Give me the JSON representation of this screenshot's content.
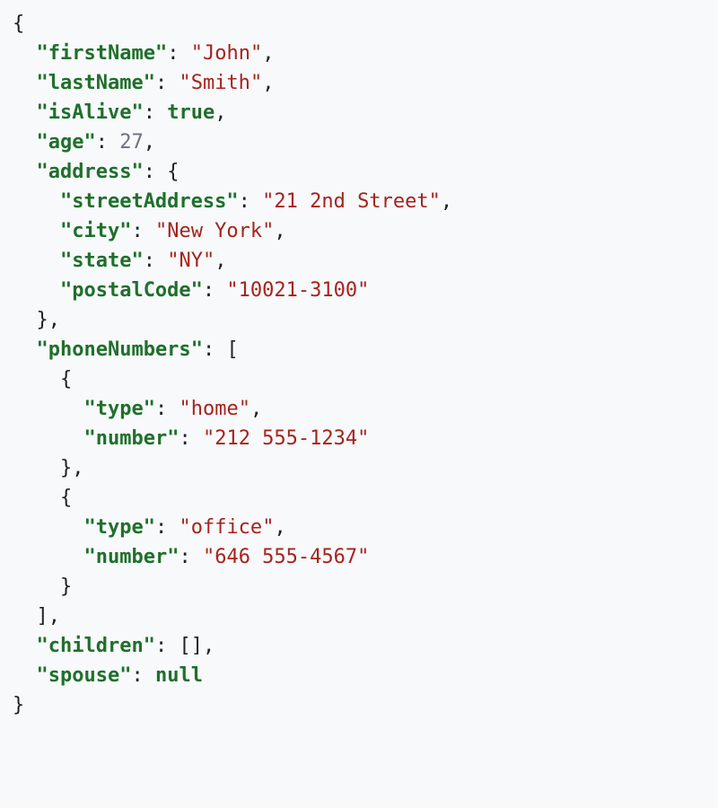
{
  "json_doc": {
    "firstName": {
      "key": "firstName",
      "value": "John"
    },
    "lastName": {
      "key": "lastName",
      "value": "Smith"
    },
    "isAlive": {
      "key": "isAlive",
      "value": "true"
    },
    "age": {
      "key": "age",
      "value": "27"
    },
    "address": {
      "key": "address",
      "streetAddress": {
        "key": "streetAddress",
        "value": "21 2nd Street"
      },
      "city": {
        "key": "city",
        "value": "New York"
      },
      "state": {
        "key": "state",
        "value": "NY"
      },
      "postalCode": {
        "key": "postalCode",
        "value": "10021-3100"
      }
    },
    "phoneNumbers": {
      "key": "phoneNumbers",
      "items": [
        {
          "type": {
            "key": "type",
            "value": "home"
          },
          "number": {
            "key": "number",
            "value": "212 555-1234"
          }
        },
        {
          "type": {
            "key": "type",
            "value": "office"
          },
          "number": {
            "key": "number",
            "value": "646 555-4567"
          }
        }
      ]
    },
    "children": {
      "key": "children",
      "value": "[]"
    },
    "spouse": {
      "key": "spouse",
      "value": "null"
    }
  },
  "q": "\""
}
